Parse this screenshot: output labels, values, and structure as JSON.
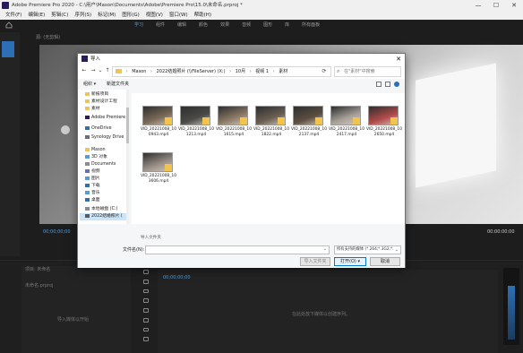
{
  "app": {
    "title": "Adobe Premiere Pro 2020 - C:\\用户\\Mason\\Documents\\Adobe\\Premiere Pro\\15.0\\未命名.prproj *",
    "window_controls": [
      "—",
      "☐",
      "✕"
    ]
  },
  "menu": [
    "文件(F)",
    "编辑(E)",
    "剪辑(C)",
    "序列(S)",
    "标记(M)",
    "图形(G)",
    "视图(V)",
    "窗口(W)",
    "帮助(H)"
  ],
  "workspaces": {
    "tabs": [
      "学习",
      "组件",
      "编辑",
      "颜色",
      "效果",
      "音频",
      "图形",
      "库",
      "所有面板"
    ],
    "active_index": 0
  },
  "source_tab": "源: (无剪辑)",
  "timecode_left": "00;00;00;00",
  "timecode_right": "00:00:00:00",
  "lower": {
    "project_label": "项目: 未命名",
    "project_file": "未命名.prproj",
    "import_hint": "导入媒体以开始",
    "timeline_hint": "在此处放下媒体以创建序列。",
    "timeline_tc": "00;00;00;00"
  },
  "dialog": {
    "title": "导入",
    "address": {
      "path": [
        "Mason",
        "2022结婚照片 (\\\\FileServer) (X:)",
        "10月",
        "视频 1",
        "素材"
      ],
      "search_placeholder": "在\"素材\"中搜索"
    },
    "toolbar": {
      "organize": "组织 ▾",
      "new_folder": "新建文件夹"
    },
    "nav": [
      {
        "label": "新报项目",
        "icon": "folder-icon",
        "color": "#f2c44d"
      },
      {
        "label": "素材设计工程",
        "icon": "folder-icon",
        "color": "#f2c44d"
      },
      {
        "label": "素材",
        "icon": "folder-icon",
        "color": "#f2c44d"
      },
      {
        "label": "Adobe Premiere",
        "icon": "premiere-icon",
        "color": "#2a1a5e"
      },
      {
        "label": "OneDrive",
        "icon": "cloud-icon",
        "color": "#2d6fb5"
      },
      {
        "label": "Synology Drive",
        "icon": "drive-icon",
        "color": "#6e6e6e"
      },
      {
        "label": "Mason",
        "icon": "user-icon",
        "color": "#f2c44d"
      },
      {
        "label": "3D 对象",
        "icon": "cube-icon",
        "color": "#4d9de0"
      },
      {
        "label": "Documents",
        "icon": "doc-icon",
        "color": "#8c8c8c"
      },
      {
        "label": "视频",
        "icon": "video-icon",
        "color": "#6c6cb5"
      },
      {
        "label": "图片",
        "icon": "picture-icon",
        "color": "#4d9de0"
      },
      {
        "label": "下载",
        "icon": "download-icon",
        "color": "#2d6fb5"
      },
      {
        "label": "音乐",
        "icon": "music-icon",
        "color": "#4d9de0"
      },
      {
        "label": "桌面",
        "icon": "desktop-icon",
        "color": "#2d6fb5"
      },
      {
        "label": "本地磁盘 (C:)",
        "icon": "disk-icon",
        "color": "#8c8c8c"
      },
      {
        "label": "2022结婚照片 (",
        "icon": "network-drive-icon",
        "color": "#5a5a5a"
      }
    ],
    "files": [
      {
        "name": "VID_20221008_100943.mp4",
        "scene": "#7a6a58"
      },
      {
        "name": "VID_20221008_101213.mp4",
        "scene": "#4a4a48"
      },
      {
        "name": "VID_20221008_101615.mp4",
        "scene": "#8c7a66"
      },
      {
        "name": "VID_20221008_101822.mp4",
        "scene": "#6a5e52"
      },
      {
        "name": "VID_20221008_102137.mp4",
        "scene": "#5c4e40"
      },
      {
        "name": "VID_20221008_102417.mp4",
        "scene": "#a8a19a"
      },
      {
        "name": "VID_20221008_102650.mp4",
        "scene": "#b14a4a"
      },
      {
        "name": "VID_20221008_103606.mp4",
        "scene": "#9a9088"
      }
    ],
    "selection_status": "导入文件夹",
    "filename_label": "文件名(N):",
    "filename_value": "",
    "filetype_value": "所有支持的媒体 (*.264;*.3G2;*.",
    "buttons": {
      "import_folder": "导入文件夹",
      "open": "打开(O) ▾",
      "cancel": "取消"
    }
  }
}
